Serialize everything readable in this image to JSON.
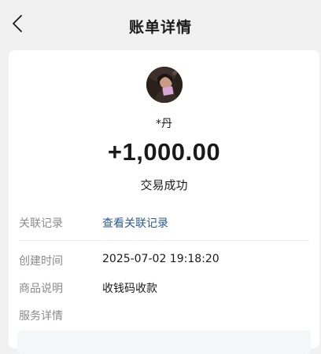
{
  "header": {
    "title": "账单详情",
    "back_icon": "chevron-left-icon"
  },
  "transaction": {
    "payer_name": "*丹",
    "amount": "+1,000.00",
    "status": "交易成功"
  },
  "details": {
    "related_label": "关联记录",
    "related_link": "查看关联记录",
    "created_label": "创建时间",
    "created_value": "2025-07-02 19:18:20",
    "product_label": "商品说明",
    "product_value": "收钱码收款",
    "service_label": "服务详情"
  },
  "colors": {
    "link": "#2a5c96",
    "label": "#8a8a8a",
    "background": "#f1f1f1"
  }
}
